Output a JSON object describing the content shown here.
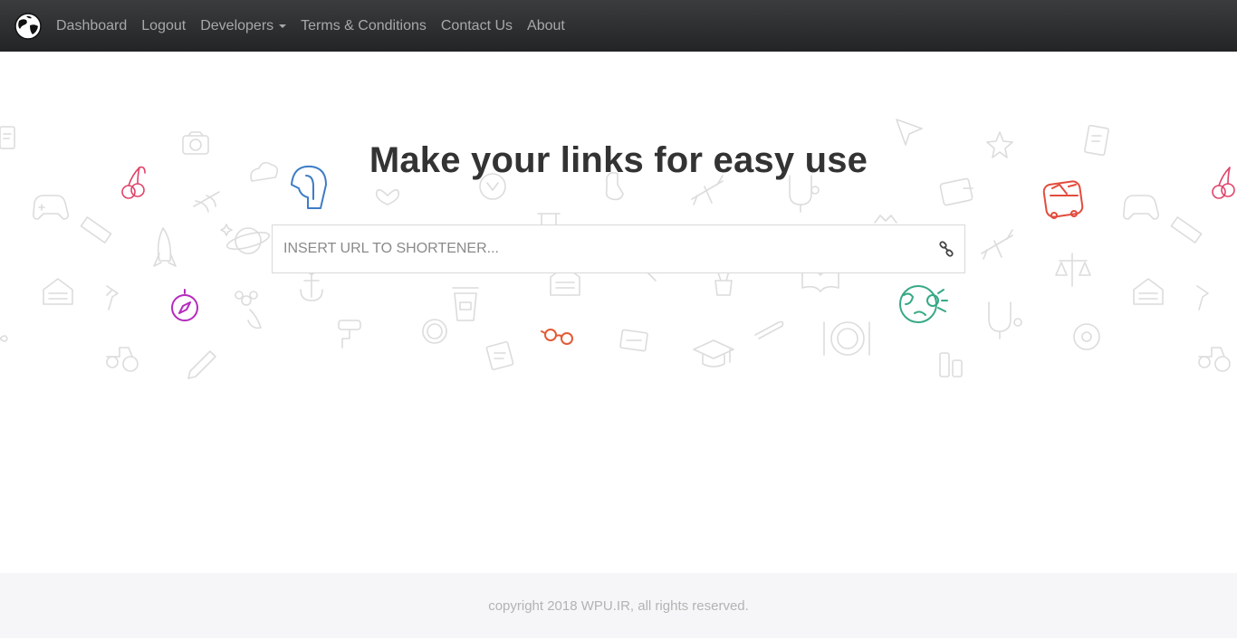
{
  "nav": {
    "items": [
      {
        "label": "Dashboard"
      },
      {
        "label": "Logout"
      },
      {
        "label": "Developers"
      },
      {
        "label": "Terms & Conditions"
      },
      {
        "label": "Contact Us"
      },
      {
        "label": "About"
      }
    ],
    "brand_icon": "globe-logo-icon"
  },
  "hero": {
    "title": "Make your links for easy use"
  },
  "search": {
    "placeholder": "INSERT URL TO SHORTENER...",
    "value": "",
    "button_icon": "link-icon"
  },
  "footer": {
    "text": "copyright 2018 WPU.IR, all rights reserved."
  },
  "colors": {
    "navbar": "#2b2d2f",
    "nav_text": "#a8a8a8",
    "title": "#333333",
    "doodle_gray": "#dddddd",
    "footer_bg": "#f6f6f8",
    "footer_text": "#b3b3b3"
  }
}
